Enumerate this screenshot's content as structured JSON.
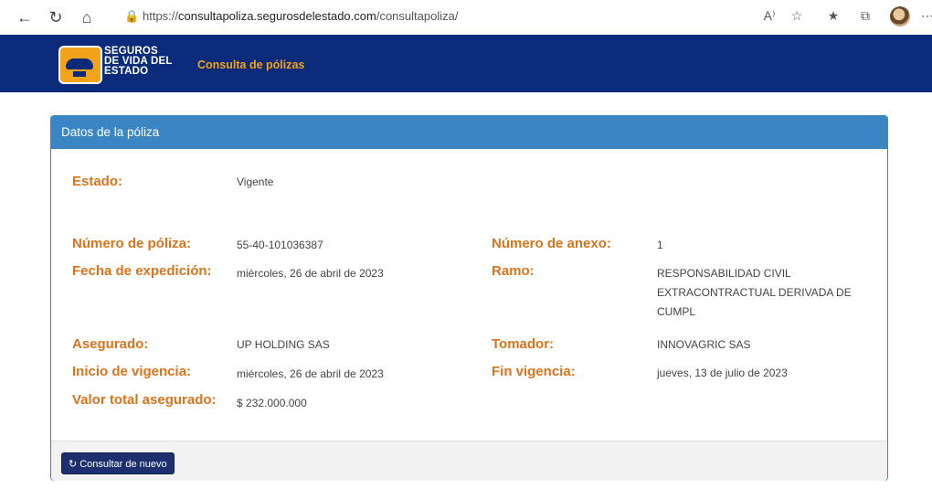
{
  "browser": {
    "url_prefix": "https://",
    "url_host": "consultapoliza.segurosdelestado.com",
    "url_path": "/consultapoliza/"
  },
  "header": {
    "logo_line1": "SEGUROS",
    "logo_line2": "DE VIDA DEL",
    "logo_line3": "ESTADO",
    "nav_link": "Consulta de pólizas"
  },
  "card": {
    "title": "Datos de la póliza",
    "fields": {
      "estado": {
        "label": "Estado:",
        "value": "Vigente"
      },
      "numero_poliza": {
        "label": "Número de póliza:",
        "value": "55-40-101036387"
      },
      "numero_anexo": {
        "label": "Número de anexo:",
        "value": "1"
      },
      "fecha_expedicion": {
        "label": "Fecha de expedición:",
        "value": "miércoles, 26 de abril de 2023"
      },
      "ramo": {
        "label": "Ramo:",
        "value_line1": "RESPONSABILIDAD CIVIL",
        "value_line2": "EXTRACONTRACTUAL DERIVADA DE",
        "value_line3": "CUMPL"
      },
      "asegurado": {
        "label": "Asegurado:",
        "value": "UP HOLDING SAS"
      },
      "tomador": {
        "label": "Tomador:",
        "value": "INNOVAGRIC SAS"
      },
      "inicio_vigencia": {
        "label": "Inicio de vigencia:",
        "value": "miércoles, 26 de abril de 2023"
      },
      "fin_vigencia": {
        "label": "Fin vigencia:",
        "value": "jueves, 13 de julio de 2023"
      },
      "valor_total": {
        "label": "Valor total asegurado:",
        "value": "$ 232.000.000"
      }
    },
    "button_label": "Consultar de nuevo"
  },
  "colors": {
    "header_bg": "#0a2a7a",
    "accent_orange": "#d9731c",
    "card_header": "#3a86c4",
    "button": "#1d2f6e"
  }
}
